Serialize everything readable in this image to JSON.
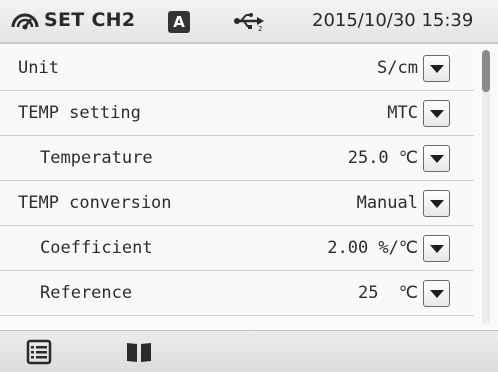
{
  "header": {
    "title": "SET CH2",
    "mode_badge": "A",
    "datetime": "2015/10/30 15:39",
    "icons": [
      "sensor-icon",
      "usb-icon"
    ]
  },
  "rows": [
    {
      "label": "Unit",
      "value": "S/cm"
    },
    {
      "label": "TEMP setting",
      "value": "MTC"
    },
    {
      "label": "Temperature",
      "value": "25.0 ℃"
    },
    {
      "label": "TEMP conversion",
      "value": "Manual"
    },
    {
      "label": "Coefficient",
      "value": "2.00 %/℃"
    },
    {
      "label": "Reference",
      "value": "25  ℃"
    }
  ],
  "toolbar": {
    "icons": [
      "menu-list-icon",
      "manual-book-icon"
    ]
  },
  "colors": {
    "text": "#2a2a2a",
    "header_bg": "#e9e9e9",
    "row_bg": "#f9f9f9",
    "divider": "#cfcfcf",
    "scroll_thumb": "#8a8a8a"
  }
}
